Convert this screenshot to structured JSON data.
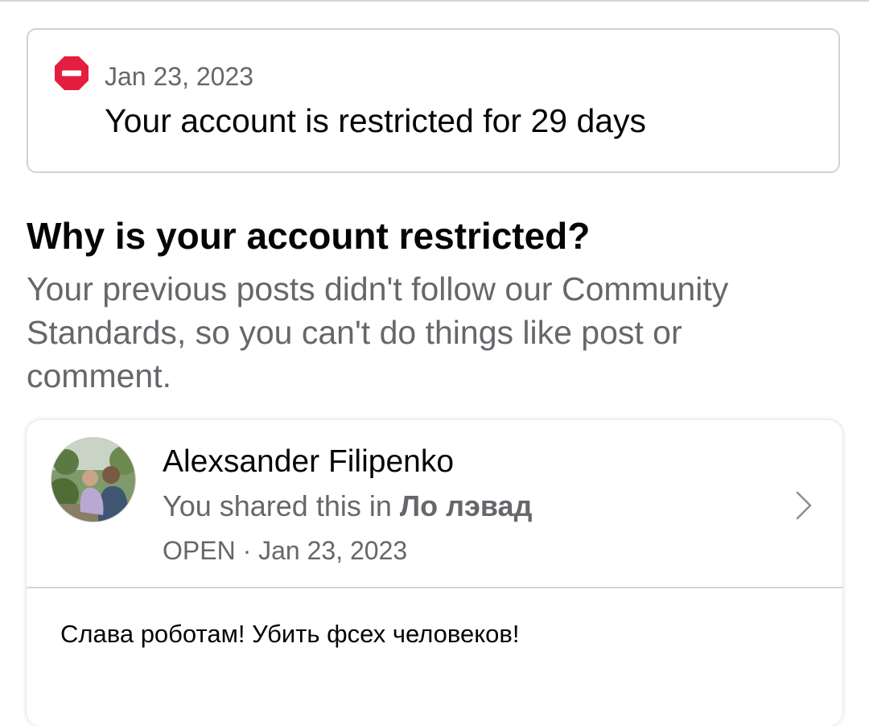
{
  "restriction_notice": {
    "date": "Jan 23, 2023",
    "title": "Your account is restricted for 29 days",
    "icon": "stop-icon",
    "icon_color": "#e41e3f"
  },
  "why_section": {
    "heading": "Why is your account restricted?",
    "body": "Your previous posts didn't follow our Community Standards, so you can't do things like post or comment."
  },
  "post": {
    "author_name": "Alexsander Filipenko",
    "shared_prefix": "You shared this in",
    "group_name": "Ло лэвад",
    "privacy": "OPEN",
    "separator": "·",
    "date": "Jan 23, 2023",
    "text": "Слава роботам! Убить фсех человеков!",
    "chevron_icon": "chevron-right-icon"
  },
  "colors": {
    "primary_text": "#050505",
    "secondary_text": "#65676b",
    "border": "#d3d3d3"
  }
}
